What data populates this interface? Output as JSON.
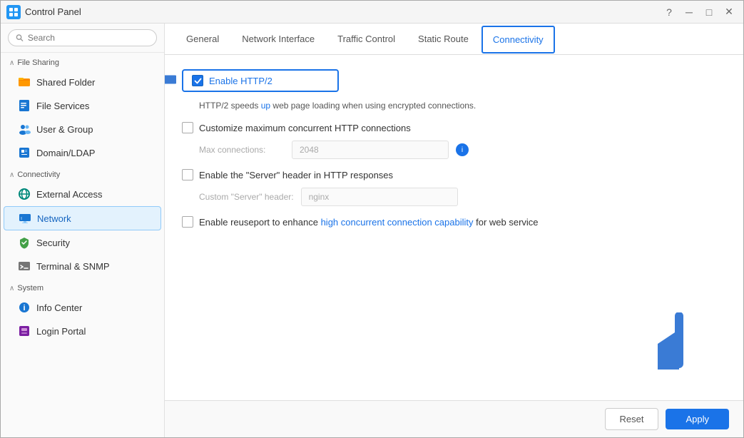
{
  "window": {
    "title": "Control Panel"
  },
  "titlebar": {
    "title": "Control Panel",
    "buttons": [
      "?",
      "—",
      "□",
      "✕"
    ]
  },
  "sidebar": {
    "search_placeholder": "Search",
    "sections": [
      {
        "id": "file-sharing",
        "label": "File Sharing",
        "expanded": true,
        "items": [
          {
            "id": "shared-folder",
            "label": "Shared Folder",
            "icon": "folder-orange"
          },
          {
            "id": "file-services",
            "label": "File Services",
            "icon": "file-services-blue"
          },
          {
            "id": "user-group",
            "label": "User & Group",
            "icon": "user-blue"
          },
          {
            "id": "domain-ldap",
            "label": "Domain/LDAP",
            "icon": "domain-blue"
          }
        ]
      },
      {
        "id": "connectivity",
        "label": "Connectivity",
        "expanded": true,
        "items": [
          {
            "id": "external-access",
            "label": "External Access",
            "icon": "external-teal"
          },
          {
            "id": "network",
            "label": "Network",
            "icon": "network-home",
            "active": true
          },
          {
            "id": "security",
            "label": "Security",
            "icon": "security-green"
          },
          {
            "id": "terminal-snmp",
            "label": "Terminal & SNMP",
            "icon": "terminal-gray"
          }
        ]
      },
      {
        "id": "system",
        "label": "System",
        "expanded": true,
        "items": [
          {
            "id": "info-center",
            "label": "Info Center",
            "icon": "info-blue"
          },
          {
            "id": "login-portal",
            "label": "Login Portal",
            "icon": "login-purple"
          }
        ]
      }
    ]
  },
  "tabs": [
    {
      "id": "general",
      "label": "General"
    },
    {
      "id": "network-interface",
      "label": "Network Interface"
    },
    {
      "id": "traffic-control",
      "label": "Traffic Control"
    },
    {
      "id": "static-route",
      "label": "Static Route"
    },
    {
      "id": "connectivity",
      "label": "Connectivity",
      "active": true
    }
  ],
  "connectivity_tab": {
    "enable_http2": {
      "checked": true,
      "label": "Enable HTTP/2",
      "description_parts": [
        {
          "text": "HTTP/2 speeds ",
          "highlight": false
        },
        {
          "text": "up",
          "highlight": true
        },
        {
          "text": " web page loading when using encrypted connections.",
          "highlight": false
        }
      ]
    },
    "customize_max": {
      "checked": false,
      "label": "Customize maximum concurrent HTTP connections"
    },
    "max_connections": {
      "label": "Max connections:",
      "value": "2048"
    },
    "enable_server_header": {
      "checked": false,
      "label": "Enable the \"Server\" header in HTTP responses"
    },
    "custom_server_header": {
      "label": "Custom \"Server\" header:",
      "value": "nginx"
    },
    "enable_reuseport": {
      "checked": false,
      "label_parts": [
        {
          "text": "Enable reuseport to enhance ",
          "highlight": false
        },
        {
          "text": "high concurrent connection capability",
          "highlight": true
        },
        {
          "text": " for web service",
          "highlight": false
        }
      ]
    }
  },
  "footer": {
    "reset_label": "Reset",
    "apply_label": "Apply"
  }
}
